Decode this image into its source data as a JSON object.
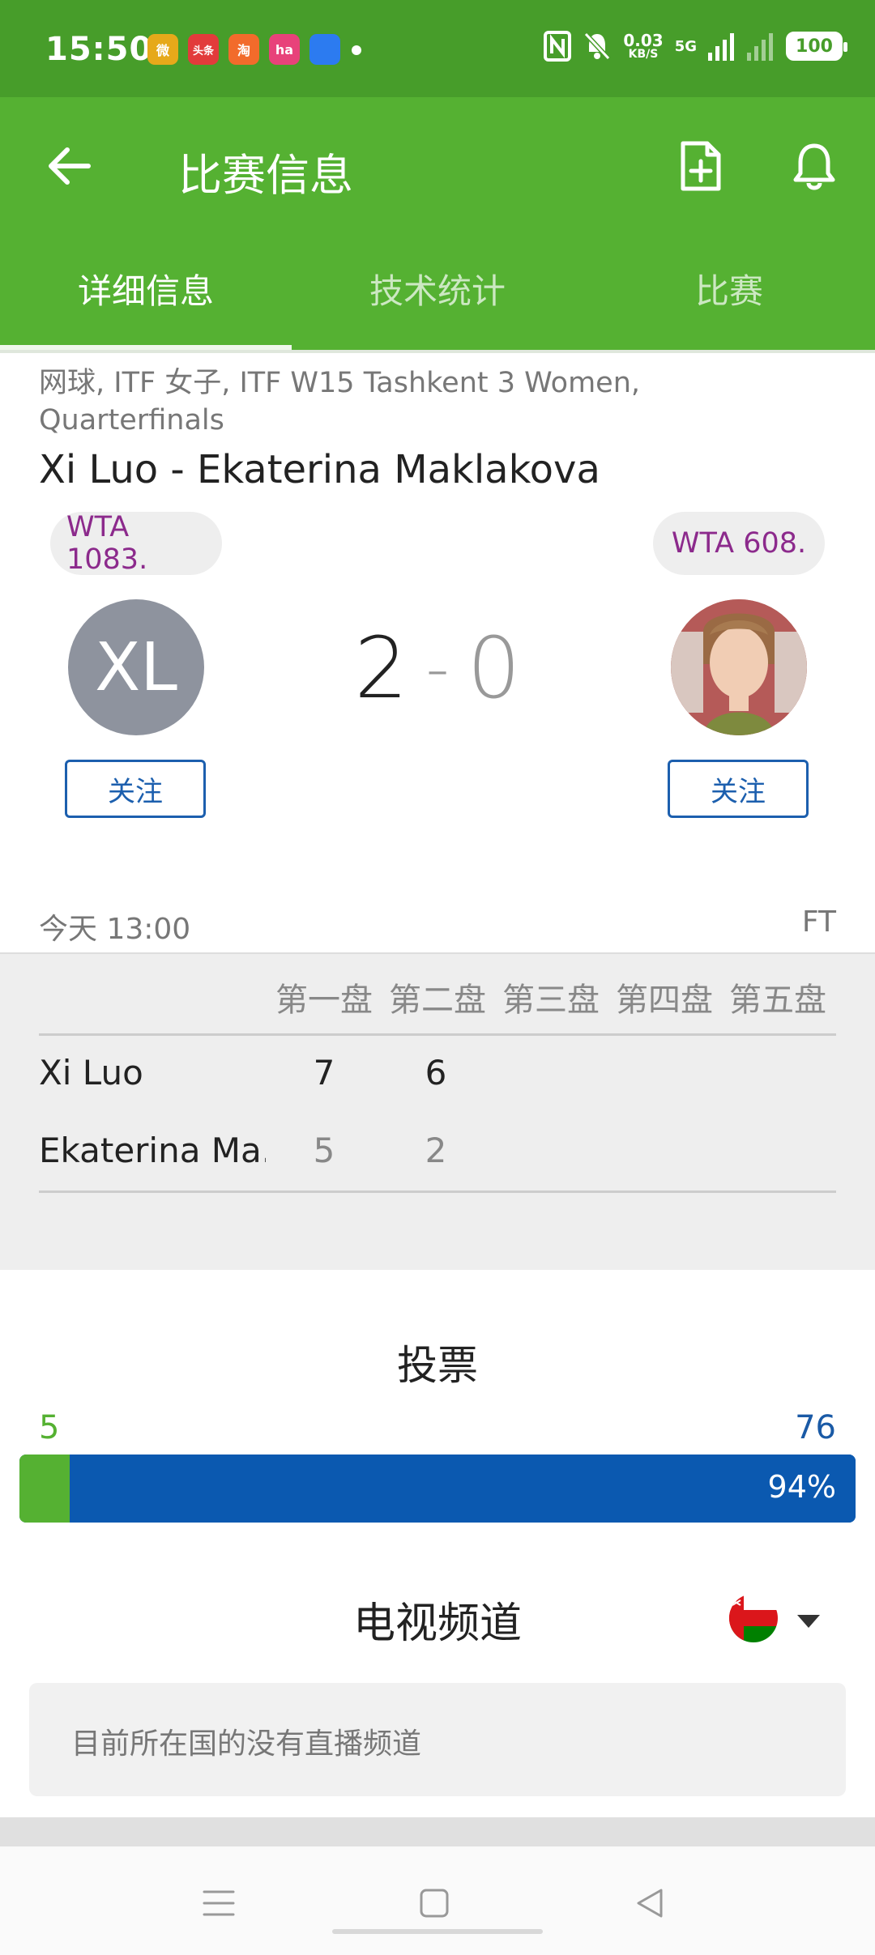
{
  "status_bar": {
    "time": "15:50",
    "apps": [
      {
        "name": "weibo-icon",
        "label": "微",
        "color": "#e6a91a"
      },
      {
        "name": "toutiao-icon",
        "label": "头条",
        "color": "#e23b3b"
      },
      {
        "name": "taobao-icon",
        "label": "淘",
        "color": "#f26b2b"
      },
      {
        "name": "music-icon",
        "label": "ha",
        "color": "#e8427a"
      },
      {
        "name": "browser-icon",
        "label": "",
        "color": "#2c7bf0"
      }
    ],
    "net_speed": "0.03",
    "net_unit": "KB/S",
    "net_type": "5G",
    "battery": "100"
  },
  "appbar": {
    "title": "比赛信息"
  },
  "tabs": [
    {
      "label": "详细信息",
      "active": true
    },
    {
      "label": "技术统计",
      "active": false
    },
    {
      "label": "比赛",
      "active": false
    }
  ],
  "match": {
    "breadcrumb": "网球, ITF 女子, ITF W15 Tashkent 3 Women, Quarterfinals",
    "title": "Xi Luo - Ekaterina Maklakova",
    "home": {
      "rank": "WTA 1083.",
      "initials": "XL",
      "follow": "关注"
    },
    "away": {
      "rank": "WTA 608.",
      "follow": "关注"
    },
    "score_home": "2",
    "score_sep": "-",
    "score_away": "0",
    "time": "今天 13:00",
    "status": "FT"
  },
  "sets": {
    "headers": [
      "第一盘",
      "第二盘",
      "第三盘",
      "第四盘",
      "第五盘"
    ],
    "rows": [
      {
        "name": "Xi Luo",
        "scores": [
          "7",
          "6"
        ]
      },
      {
        "name": "Ekaterina Ma...",
        "scores": [
          "5",
          "2"
        ]
      }
    ]
  },
  "votes": {
    "title": "投票",
    "home_count": "5",
    "away_count": "76",
    "away_pct": "94%",
    "home_share": 0.06,
    "colors": {
      "home": "#55b132",
      "away": "#0b59b0"
    }
  },
  "tv": {
    "title": "电视频道",
    "message": "目前所在国的没有直播频道"
  },
  "colors": {
    "statusbar": "#479d2a",
    "primary": "#55b132",
    "link": "#1c5fae",
    "rank": "#8c2a8c"
  }
}
